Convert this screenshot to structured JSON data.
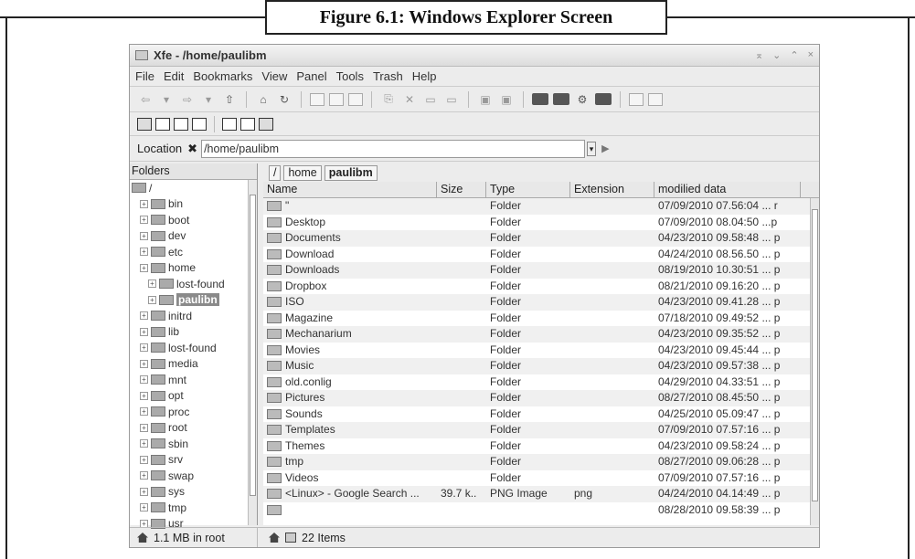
{
  "figure": {
    "caption": "Figure 6.1: Windows Explorer Screen"
  },
  "window": {
    "title": "Xfe - /home/paulibm",
    "controls": [
      "⌅",
      "⌄",
      "⌃",
      "×"
    ]
  },
  "menu": [
    "File",
    "Edit",
    "Bookmarks",
    "View",
    "Panel",
    "Tools",
    "Trash",
    "Help"
  ],
  "location": {
    "label": "Location",
    "value": "/home/paulibm"
  },
  "tree": {
    "header": "Folders",
    "items": [
      {
        "label": "/",
        "depth": 0
      },
      {
        "label": "bin",
        "depth": 1
      },
      {
        "label": "boot",
        "depth": 1
      },
      {
        "label": "dev",
        "depth": 1
      },
      {
        "label": "etc",
        "depth": 1
      },
      {
        "label": "home",
        "depth": 1
      },
      {
        "label": "lost-found",
        "depth": 2
      },
      {
        "label": "paulibn",
        "depth": 2,
        "selected": true
      },
      {
        "label": "initrd",
        "depth": 1
      },
      {
        "label": "lib",
        "depth": 1
      },
      {
        "label": "lost-found",
        "depth": 1
      },
      {
        "label": "media",
        "depth": 1
      },
      {
        "label": "mnt",
        "depth": 1
      },
      {
        "label": "opt",
        "depth": 1
      },
      {
        "label": "proc",
        "depth": 1
      },
      {
        "label": "root",
        "depth": 1
      },
      {
        "label": "sbin",
        "depth": 1
      },
      {
        "label": "srv",
        "depth": 1
      },
      {
        "label": "swap",
        "depth": 1
      },
      {
        "label": "sys",
        "depth": 1
      },
      {
        "label": "tmp",
        "depth": 1
      },
      {
        "label": "usr",
        "depth": 1
      }
    ]
  },
  "breadcrumbs": [
    "/",
    "home",
    "paulibm"
  ],
  "columns": [
    "Name",
    "Size",
    "Type",
    "Extension",
    "modilied data"
  ],
  "files": [
    {
      "name": "\"",
      "size": "",
      "type": "Folder",
      "ext": "",
      "date": "07/09/2010 07.56:04 ... r"
    },
    {
      "name": "Desktop",
      "size": "",
      "type": "Folder",
      "ext": "",
      "date": "07/09/2010 08.04:50 ...p"
    },
    {
      "name": "Documents",
      "size": "",
      "type": "Folder",
      "ext": "",
      "date": "04/23/2010 09.58:48 ... p"
    },
    {
      "name": "Download",
      "size": "",
      "type": "Folder",
      "ext": "",
      "date": "04/24/2010 08.56.50 ... p"
    },
    {
      "name": "Downloads",
      "size": "",
      "type": "Folder",
      "ext": "",
      "date": "08/19/2010 10.30:51 ... p"
    },
    {
      "name": "Dropbox",
      "size": "",
      "type": "Folder",
      "ext": "",
      "date": "08/21/2010 09.16:20 ... p"
    },
    {
      "name": "ISO",
      "size": "",
      "type": "Folder",
      "ext": "",
      "date": "04/23/2010 09.41.28 ... p"
    },
    {
      "name": "Magazine",
      "size": "",
      "type": "Folder",
      "ext": "",
      "date": "07/18/2010 09.49:52 ... p"
    },
    {
      "name": "Mechanarium",
      "size": "",
      "type": "Folder",
      "ext": "",
      "date": "04/23/2010 09.35:52 ... p"
    },
    {
      "name": "Movies",
      "size": "",
      "type": "Folder",
      "ext": "",
      "date": "04/23/2010 09.45:44 ... p"
    },
    {
      "name": "Music",
      "size": "",
      "type": "Folder",
      "ext": "",
      "date": "04/23/2010 09.57:38 ... p"
    },
    {
      "name": "old.conlig",
      "size": "",
      "type": "Folder",
      "ext": "",
      "date": "04/29/2010 04.33:51 ... p"
    },
    {
      "name": "Pictures",
      "size": "",
      "type": "Folder",
      "ext": "",
      "date": "08/27/2010 08.45:50 ... p"
    },
    {
      "name": "Sounds",
      "size": "",
      "type": "Folder",
      "ext": "",
      "date": "04/25/2010 05.09:47 ... p"
    },
    {
      "name": "Templates",
      "size": "",
      "type": "Folder",
      "ext": "",
      "date": "07/09/2010 07.57:16 ... p"
    },
    {
      "name": "Themes",
      "size": "",
      "type": "Folder",
      "ext": "",
      "date": "04/23/2010 09.58:24 ... p"
    },
    {
      "name": "tmp",
      "size": "",
      "type": "Folder",
      "ext": "",
      "date": "08/27/2010 09.06:28 ... p"
    },
    {
      "name": "Videos",
      "size": "",
      "type": "Folder",
      "ext": "",
      "date": "07/09/2010 07.57:16 ... p"
    },
    {
      "name": "<Linux> - Google Search ...",
      "size": "39.7 k..",
      "type": "PNG Image",
      "ext": "png",
      "date": "04/24/2010 04.14:49 ... p"
    },
    {
      "name": "",
      "size": "",
      "type": "",
      "ext": "",
      "date": "08/28/2010 09.58:39 ... p"
    }
  ],
  "status": {
    "left": "1.1 MB in root",
    "right": "22 Items"
  }
}
